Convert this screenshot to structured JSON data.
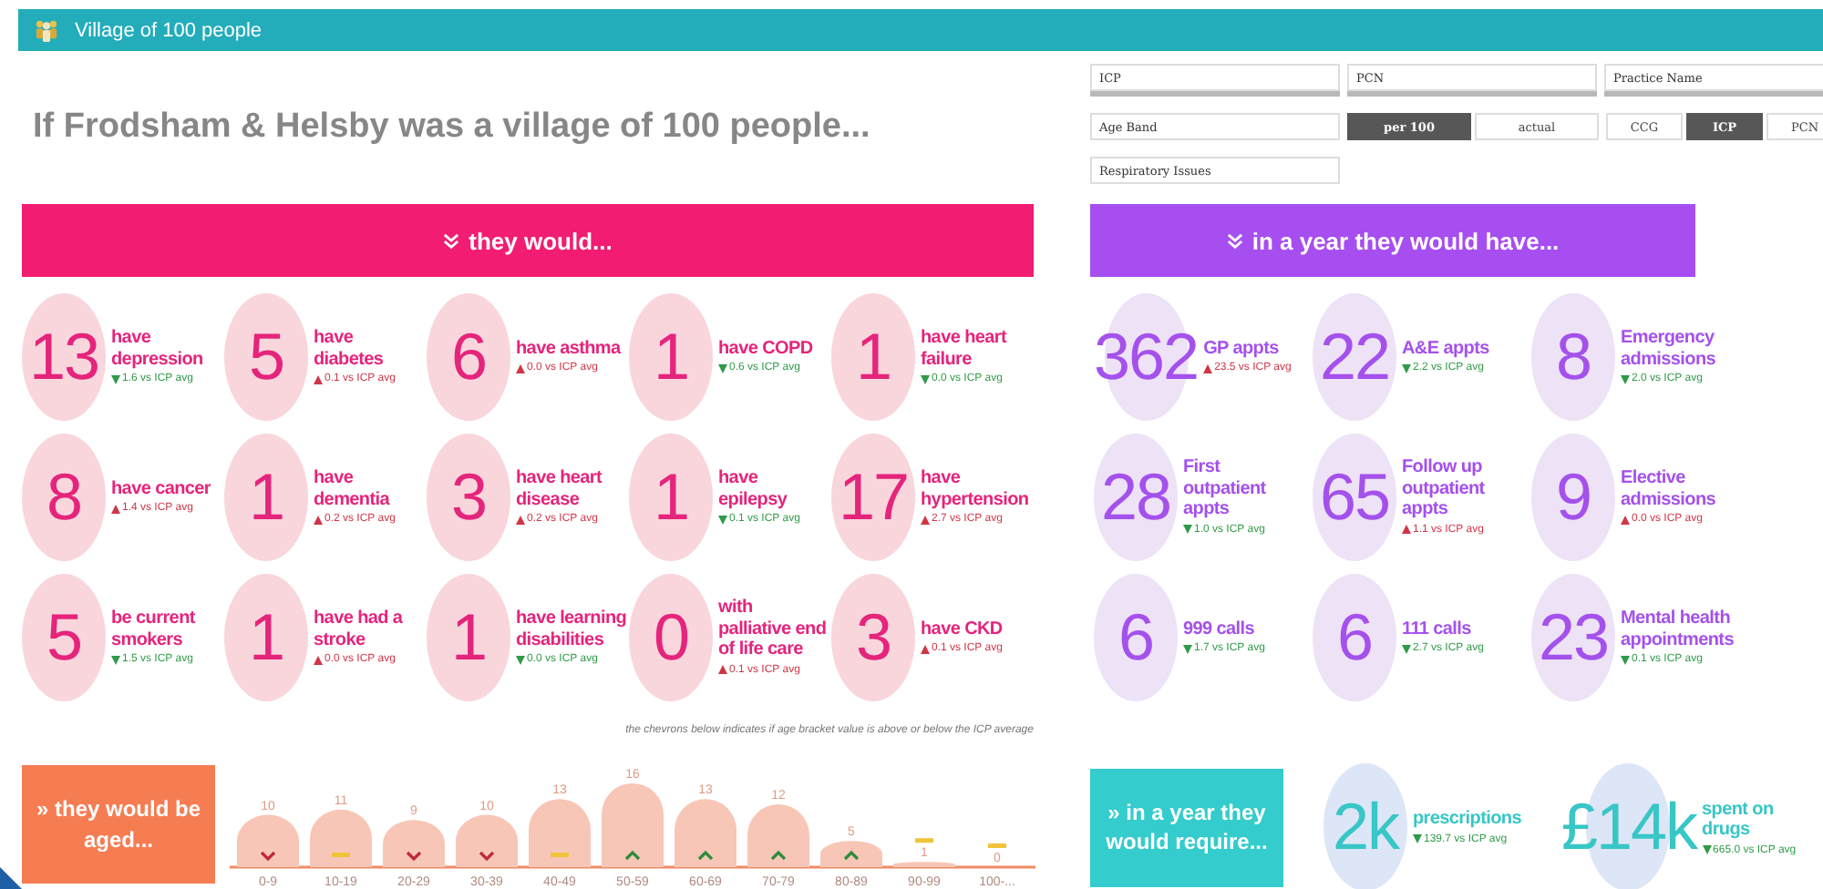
{
  "header": {
    "title": "Village of 100 people"
  },
  "heading": "If Frodsham & Helsby was a village of 100 people...",
  "filters": {
    "fields": [
      {
        "label": "ICP"
      },
      {
        "label": "PCN"
      },
      {
        "label": "Practice Name"
      }
    ],
    "age_band": {
      "label": "Age Band"
    },
    "measure_toggle": [
      {
        "label": "per 100",
        "selected": true
      },
      {
        "label": "actual",
        "selected": false
      }
    ],
    "level_toggle": [
      {
        "label": "CCG",
        "selected": false
      },
      {
        "label": "ICP",
        "selected": true
      },
      {
        "label": "PCN",
        "selected": false
      }
    ],
    "issue_field": {
      "label": "Respiratory Issues"
    }
  },
  "people": {
    "banner": "they would...",
    "stats": [
      {
        "value": "13",
        "label": "have depression",
        "above": false,
        "delta": "1.6 vs ICP avg"
      },
      {
        "value": "5",
        "label": "have diabetes",
        "above": true,
        "delta": "0.1 vs ICP avg"
      },
      {
        "value": "6",
        "label": "have asthma",
        "above": true,
        "delta": "0.0 vs ICP avg"
      },
      {
        "value": "1",
        "label": "have COPD",
        "above": false,
        "delta": "0.6 vs ICP avg"
      },
      {
        "value": "1",
        "label": "have heart failure",
        "above": false,
        "delta": "0.0 vs ICP avg"
      },
      {
        "value": "8",
        "label": "have cancer",
        "above": true,
        "delta": "1.4 vs ICP avg"
      },
      {
        "value": "1",
        "label": "have dementia",
        "above": true,
        "delta": "0.2 vs ICP avg"
      },
      {
        "value": "3",
        "label": "have heart disease",
        "above": true,
        "delta": "0.2 vs ICP avg"
      },
      {
        "value": "1",
        "label": "have epilepsy",
        "above": false,
        "delta": "0.1 vs ICP avg"
      },
      {
        "value": "17",
        "label": "have hypertension",
        "above": true,
        "delta": "2.7 vs ICP avg"
      },
      {
        "value": "5",
        "label": "be current smokers",
        "above": false,
        "delta": "1.5 vs ICP avg"
      },
      {
        "value": "1",
        "label": "have had a stroke",
        "above": true,
        "delta": "0.0 vs ICP avg"
      },
      {
        "value": "1",
        "label": "have learning disabilities",
        "above": false,
        "delta": "0.0 vs ICP avg"
      },
      {
        "value": "0",
        "label": "with palliative end of life care",
        "above": true,
        "delta": "0.1 vs ICP avg"
      },
      {
        "value": "3",
        "label": "have CKD",
        "above": true,
        "delta": "0.1 vs ICP avg"
      }
    ]
  },
  "year": {
    "banner": "in a year they would have...",
    "stats": [
      {
        "value": "362",
        "label": "GP appts",
        "above": true,
        "delta": "23.5 vs ICP avg"
      },
      {
        "value": "22",
        "label": "A&E appts",
        "above": false,
        "delta": "2.2 vs ICP avg"
      },
      {
        "value": "8",
        "label": "Emergency admissions",
        "above": false,
        "delta": "2.0 vs ICP avg"
      },
      {
        "value": "28",
        "label": "First outpatient appts",
        "above": false,
        "delta": "1.0 vs ICP avg"
      },
      {
        "value": "65",
        "label": "Follow up outpatient appts",
        "above": true,
        "delta": "1.1 vs ICP avg"
      },
      {
        "value": "9",
        "label": "Elective admissions",
        "above": true,
        "delta": "0.0 vs ICP avg"
      },
      {
        "value": "6",
        "label": "999 calls",
        "above": false,
        "delta": "1.7 vs ICP avg"
      },
      {
        "value": "6",
        "label": "111 calls",
        "above": false,
        "delta": "2.7 vs ICP avg"
      },
      {
        "value": "23",
        "label": "Mental health appointments",
        "above": false,
        "delta": "0.1 vs ICP avg"
      }
    ]
  },
  "ages": {
    "box": "» they would be aged...",
    "note": "the chevrons below indicates if age bracket value is above or below the ICP average",
    "markers": [
      {
        "kind": "below"
      },
      {
        "kind": "level"
      },
      {
        "kind": "below"
      },
      {
        "kind": "below"
      },
      {
        "kind": "level"
      },
      {
        "kind": "above"
      },
      {
        "kind": "above"
      },
      {
        "kind": "above"
      },
      {
        "kind": "above"
      },
      {
        "kind": "level"
      },
      {
        "kind": "level"
      }
    ],
    "chart_data": {
      "type": "bar",
      "categories": [
        "0-9",
        "10-19",
        "20-29",
        "30-39",
        "40-49",
        "50-59",
        "60-69",
        "70-79",
        "80-89",
        "90-99",
        "100-..."
      ],
      "series": [
        {
          "color": "#f8c6b6",
          "values": [
            10,
            11,
            9,
            10,
            13,
            16,
            13,
            12,
            5,
            1,
            0
          ]
        }
      ],
      "data_labels": true
    }
  },
  "requirements": {
    "box": "» in a year they would require...",
    "stats": [
      {
        "value": "2k",
        "label": "prescriptions",
        "above": false,
        "delta": "139.7 vs ICP avg"
      },
      {
        "value": "£14k",
        "label": "spent on drugs",
        "above": false,
        "delta": "665.0 vs ICP avg"
      }
    ]
  }
}
